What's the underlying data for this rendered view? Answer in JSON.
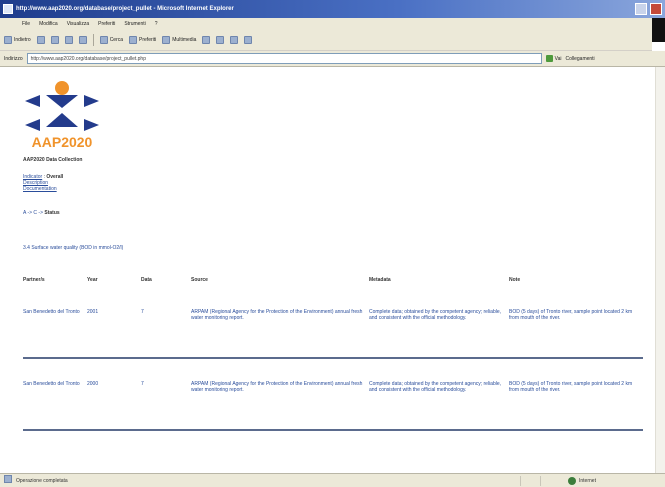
{
  "window": {
    "title": "http://www.aap2020.org/database/project_pullet - Microsoft Internet Explorer"
  },
  "menu": [
    "File",
    "Modifica",
    "Visualizza",
    "Preferiti",
    "Strumenti",
    "?"
  ],
  "toolbar": {
    "back": "Indietro",
    "search": "Cerca",
    "favorites": "Preferiti",
    "media": "Multimedia"
  },
  "address": {
    "label": "Indirizzo",
    "value": "http://www.aap2020.org/database/project_pullet.php",
    "go": "Vai",
    "links": "Collegamenti"
  },
  "page": {
    "logo_text": "AAP2020",
    "site_title": "AAP2020 Data Collection",
    "links": {
      "indicator_label": "Indicator",
      "indicator_value": "Overall",
      "description": "Description",
      "documentation": "Documentation"
    },
    "status": {
      "prefix": "A -> C ->",
      "value": "Status"
    },
    "indicator_line": "3.4  Surface water quality (BOD in mmol-O2/l)",
    "table": {
      "headers": [
        "Partner/s",
        "Year",
        "Data",
        "Source",
        "Metadata",
        "Note"
      ],
      "rows": [
        {
          "partner": "San Benedetto del Tronto",
          "year": "2001",
          "data": "7",
          "source": "ARPAM (Regional Agency for the Protection of the Environment) annual fresh water monitoring report.",
          "metadata": "Complete data; obtained by the competent agency; reliable, and consistent with the official methodology.",
          "note": "BOD (5 days) of Tronto river, sample point located 2 km from mouth of the river."
        },
        {
          "partner": "San Benedetto del Tronto",
          "year": "2000",
          "data": "7",
          "source": "ARPAM (Regional Agency for the Protection of the Environment) annual fresh water monitoring report.",
          "metadata": "Complete data; obtained by the competent agency; reliable, and consistent with the official methodology.",
          "note": "BOD (5 days) of Tronto river, sample point located 2 km from mouth of the river."
        }
      ]
    }
  },
  "statusbar": {
    "left": "Operazione completata",
    "zone": "Internet"
  },
  "colors": {
    "logo_blue": "#233b8c",
    "logo_orange": "#f0932b",
    "link": "#2a4d9b",
    "divider": "#5b6b8d"
  }
}
